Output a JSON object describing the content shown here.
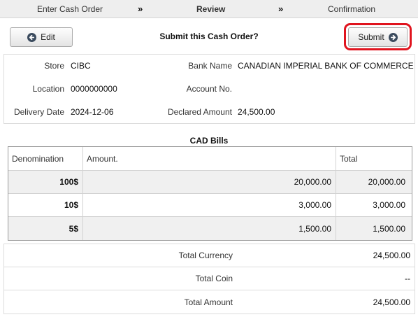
{
  "stepper": {
    "steps": [
      "Enter Cash Order",
      "Review",
      "Confirmation"
    ],
    "separator": "»",
    "active_step": "Review"
  },
  "header": {
    "edit_label": "Edit",
    "title": "Submit this Cash Order?",
    "submit_label": "Submit",
    "highlight_color": "#e0141e"
  },
  "info": {
    "store_label": "Store",
    "store_value": "CIBC",
    "bank_label": "Bank Name",
    "bank_value": "CANADIAN IMPERIAL BANK OF COMMERCE",
    "location_label": "Location",
    "location_value": "0000000000",
    "account_label": "Account No.",
    "account_value": "",
    "delivery_label": "Delivery Date",
    "delivery_value": "2024-12-06",
    "declared_label": "Declared Amount",
    "declared_value": "24,500.00"
  },
  "bills": {
    "title": "CAD Bills",
    "columns": [
      "Denomination",
      "Amount.",
      "Total"
    ],
    "rows": [
      {
        "denomination": "100$",
        "amount": "20,000.00",
        "total": "20,000.00"
      },
      {
        "denomination": "10$",
        "amount": "3,000.00",
        "total": "3,000.00"
      },
      {
        "denomination": "5$",
        "amount": "1,500.00",
        "total": "1,500.00"
      }
    ]
  },
  "totals": {
    "currency_label": "Total Currency",
    "currency_value": "24,500.00",
    "coin_label": "Total Coin",
    "coin_value": "--",
    "amount_label": "Total Amount",
    "amount_value": "24,500.00"
  },
  "icons": {
    "edit": "arrow-left-circle-icon",
    "submit": "arrow-right-circle-icon"
  }
}
